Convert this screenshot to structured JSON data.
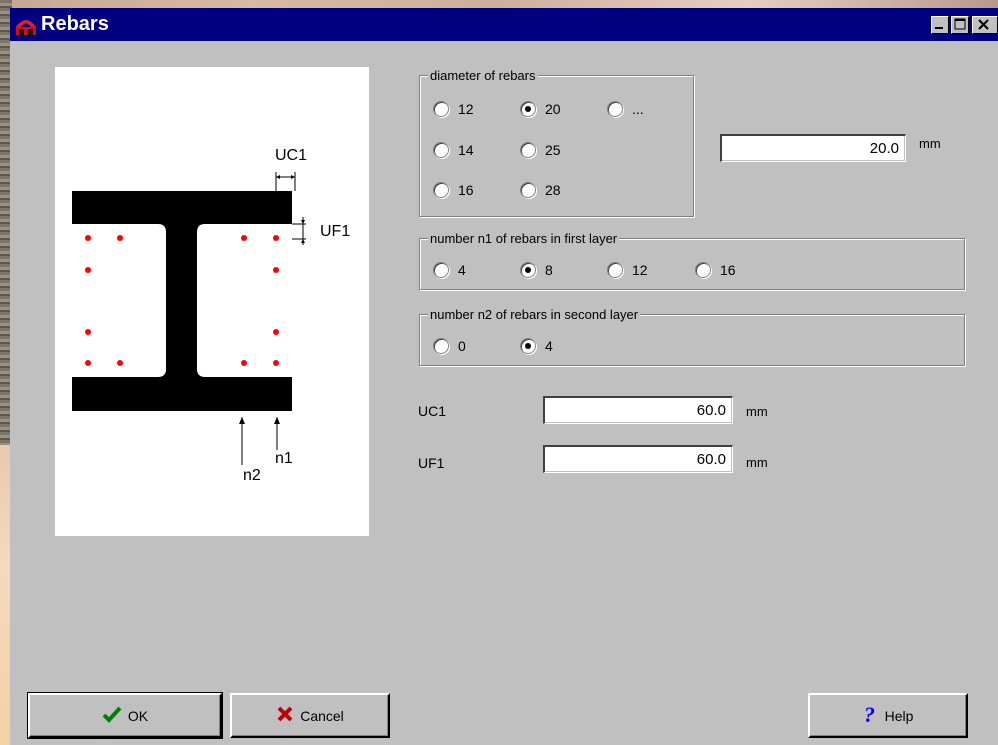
{
  "window": {
    "title": "Rebars",
    "icon": "app-arch-icon",
    "controls": [
      "minimize-icon",
      "maximize-icon",
      "close-icon"
    ]
  },
  "drawing": {
    "labels": {
      "uc1": "UC1",
      "uf1": "UF1",
      "n1": "n1",
      "n2": "n2"
    },
    "rebar_color": "#ff0000"
  },
  "diameter_group": {
    "legend": "diameter of rebars",
    "options": [
      "12",
      "20",
      "...",
      "14",
      "25",
      "16",
      "28"
    ],
    "selected": "20",
    "value": "20.0",
    "unit": "mm"
  },
  "n1_group": {
    "legend": "number n1 of rebars in first layer",
    "options": [
      "4",
      "8",
      "12",
      "16"
    ],
    "selected": "8"
  },
  "n2_group": {
    "legend": "number n2 of rebars in second layer",
    "options": [
      "0",
      "4"
    ],
    "selected": "4"
  },
  "fields": {
    "uc1": {
      "label": "UC1",
      "value": "60.0",
      "unit": "mm"
    },
    "uf1": {
      "label": "UF1",
      "value": "60.0",
      "unit": "mm"
    }
  },
  "buttons": {
    "ok": {
      "label": "OK",
      "icon": "checkmark-icon"
    },
    "cancel": {
      "label": "Cancel",
      "icon": "x-cross-icon"
    },
    "help": {
      "label": "Help",
      "icon": "question-mark-icon"
    }
  },
  "colors": {
    "titlebar": "#000080",
    "dialog_face": "#c0c0c0",
    "ok_check": "#008000",
    "cancel_x": "#c00000",
    "help_q": "#0000ff"
  }
}
